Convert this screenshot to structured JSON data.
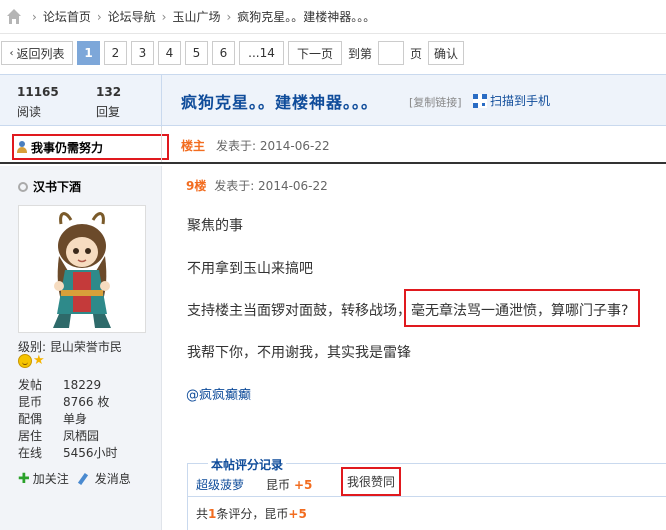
{
  "breadcrumb": {
    "items": [
      "论坛首页",
      "论坛导航",
      "玉山广场",
      "疯狗克星。。建楼神器。。。"
    ],
    "separator": "›"
  },
  "pager": {
    "back_label": "返回列表",
    "pages": [
      "1",
      "2",
      "3",
      "4",
      "5",
      "6"
    ],
    "current": "1",
    "last_label": "...14",
    "next_label": "下一页",
    "jump_label": "到第",
    "jump_value": "",
    "page_unit": "页",
    "confirm_label": "确认"
  },
  "thread": {
    "views_count": "11165",
    "views_label": "阅读",
    "replies_count": "132",
    "replies_label": "回复",
    "title": "疯狗克星。。建楼神器。。。",
    "copy_link": "[复制链接]",
    "scan_label": "扫描到手机"
  },
  "op": {
    "name": "我事仍需努力",
    "badge": "楼主",
    "posted": "发表于: 2014-06-22"
  },
  "author": {
    "name": "汉书下酒",
    "level_label": "级别:",
    "level_value": "昆山荣誉市民",
    "fields": [
      {
        "k": "发帖",
        "v": "18229"
      },
      {
        "k": "昆币",
        "v": "8766 枚"
      },
      {
        "k": "配偶",
        "v": "单身"
      },
      {
        "k": "居住",
        "v": "凤栖园"
      },
      {
        "k": "在线",
        "v": "5456小时"
      }
    ],
    "follow_label": "加关注",
    "message_label": "发消息"
  },
  "post": {
    "floor": "9楼",
    "posted": "发表于: 2014-06-22",
    "lines": [
      "聚焦的事",
      "不用拿到玉山来搞吧",
      "支持楼主当面锣对面鼓，转移战场，毫无章法骂一通泄愤，算哪门子事?",
      "我帮下你，不用谢我，其实我是雷锋"
    ],
    "mention": "@疯疯癫癫"
  },
  "rating": {
    "title": "本帖评分记录",
    "rater": "超级菠萝",
    "currency": "昆币",
    "amount": "+5",
    "reason": "我很赞同",
    "summary_prefix": "共",
    "summary_count": "1",
    "summary_mid": "条评分，昆币",
    "summary_total": "+5"
  },
  "colors": {
    "link_blue": "#0f4c9a",
    "accent_orange": "#f26c1f",
    "highlight_red": "#e0191e",
    "active_page": "#7da7d9"
  }
}
